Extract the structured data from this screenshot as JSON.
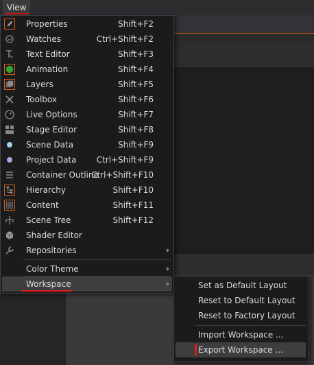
{
  "menubar": {
    "view_label": "View"
  },
  "view_menu": {
    "items": [
      {
        "label": "Properties",
        "shortcut": "Shift+F2",
        "icon": "pencil-icon"
      },
      {
        "label": "Watches",
        "shortcut": "Ctrl+Shift+F2",
        "icon": "watch-icon"
      },
      {
        "label": "Text Editor",
        "shortcut": "Shift+F3",
        "icon": "text-tool-icon"
      },
      {
        "label": "Animation",
        "shortcut": "Shift+F4",
        "icon": "animation-icon"
      },
      {
        "label": "Layers",
        "shortcut": "Shift+F5",
        "icon": "layers-icon"
      },
      {
        "label": "Toolbox",
        "shortcut": "Shift+F6",
        "icon": "tools-icon"
      },
      {
        "label": "Live Options",
        "shortcut": "Shift+F7",
        "icon": "gauge-icon"
      },
      {
        "label": "Stage Editor",
        "shortcut": "Shift+F8",
        "icon": "stage-grid-icon"
      },
      {
        "label": "Scene Data",
        "shortcut": "Shift+F9",
        "icon": "scene-data-dot-icon"
      },
      {
        "label": "Project Data",
        "shortcut": "Ctrl+Shift+F9",
        "icon": "project-data-dot-icon"
      },
      {
        "label": "Container Outline",
        "shortcut": "Ctrl+Shift+F10",
        "icon": "outline-list-icon"
      },
      {
        "label": "Hierarchy",
        "shortcut": "Shift+F10",
        "icon": "hierarchy-icon"
      },
      {
        "label": "Content",
        "shortcut": "Shift+F11",
        "icon": "content-grid-icon"
      },
      {
        "label": "Scene Tree",
        "shortcut": "Shift+F12",
        "icon": "scene-tree-icon"
      },
      {
        "label": "Shader Editor",
        "shortcut": "",
        "icon": "shader-cube-icon"
      },
      {
        "label": "Repositories",
        "shortcut": "",
        "icon": "wrench-icon"
      }
    ],
    "color_theme": "Color Theme",
    "workspace": "Workspace"
  },
  "workspace_menu": {
    "items": [
      "Set as Default Layout",
      "Reset to Default Layout",
      "Reset to Factory Layout",
      "Import Workspace ...",
      "Export Workspace ..."
    ]
  },
  "colors": {
    "accent_orange": "#d35d1a",
    "marker_red": "#e21b1b",
    "menu_bg": "#1b1b1c",
    "highlight": "#3e3e40"
  }
}
